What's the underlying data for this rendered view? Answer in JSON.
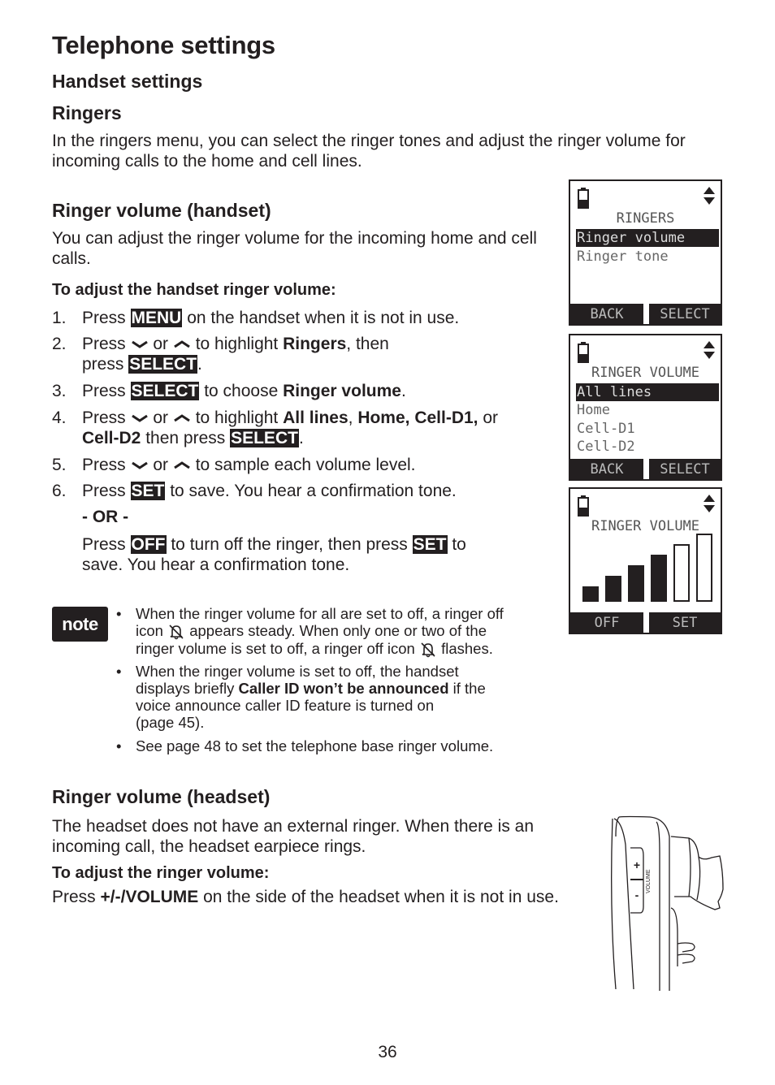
{
  "page": {
    "title": "Telephone settings",
    "section": "Handset settings",
    "subsection": "Ringers",
    "intro": "In the ringers menu, you can select the ringer tones and adjust the ringer volume for incoming calls to the home and cell lines.",
    "page_number": "36"
  },
  "handset": {
    "heading": "Ringer volume (handset)",
    "desc": "You can adjust the ringer volume for the incoming home and cell calls.",
    "procedure_title": "To adjust the handset ringer volume:",
    "steps": [
      {
        "num": "1.",
        "parts": [
          "Press ",
          "MENU",
          " on the handset when it is not in use."
        ]
      },
      {
        "num": "2.",
        "parts": [
          "Press ",
          " or ",
          " to highlight ",
          "Ringers",
          ", then",
          "press ",
          "SELECT",
          "."
        ]
      },
      {
        "num": "3.",
        "parts": [
          "Press ",
          "SELECT",
          " to choose ",
          "Ringer volume",
          "."
        ]
      },
      {
        "num": "4.",
        "parts": [
          "Press ",
          " or ",
          " to highlight ",
          "All lines",
          ", ",
          "Home, Cell-D1,",
          " or",
          "Cell-D2",
          " then press ",
          "SELECT",
          "."
        ]
      },
      {
        "num": "5.",
        "parts": [
          "Press ",
          " or ",
          " to sample each volume level."
        ]
      },
      {
        "num": "6.",
        "parts": [
          "Press ",
          "SET",
          " to save. You hear a confirmation tone."
        ]
      }
    ],
    "or_label": "- OR -",
    "alt": {
      "parts": [
        "Press ",
        "OFF",
        " to turn off the ringer, then press ",
        "SET",
        " to",
        "save. You hear a confirmation tone."
      ]
    }
  },
  "note": {
    "badge": "note",
    "bullets": [
      {
        "parts": [
          "When the ringer volume for all are set to off, a ringer off",
          "icon ",
          " appears steady. When only one or two of the",
          "ringer volume is set to off, a ringer off icon ",
          " flashes."
        ]
      },
      {
        "parts": [
          "When the ringer volume is set to off, the handset",
          "displays briefly ",
          "Caller ID won’t be announced",
          " if the",
          "voice announce caller ID feature is turned on",
          "(page 45)."
        ]
      },
      {
        "parts": [
          "See page 48 to set the telephone base ringer volume."
        ]
      }
    ],
    "bullet_char": "•"
  },
  "screens": [
    {
      "title": "RINGERS",
      "rows": [
        {
          "label": "Ringer volume",
          "selected": true
        },
        {
          "label": "Ringer tone",
          "selected": false
        }
      ],
      "softkeys": [
        "BACK",
        "SELECT"
      ]
    },
    {
      "title": "RINGER VOLUME",
      "rows": [
        {
          "label": "All lines",
          "selected": true
        },
        {
          "label": "Home",
          "selected": false
        },
        {
          "label": "Cell-D1",
          "selected": false
        },
        {
          "label": "Cell-D2",
          "selected": false
        }
      ],
      "softkeys": [
        "BACK",
        "SELECT"
      ]
    },
    {
      "title": "RINGER VOLUME",
      "volume_level": 4,
      "volume_max": 6,
      "softkeys": [
        "OFF",
        "SET"
      ]
    }
  ],
  "headset": {
    "heading": "Ringer volume (headset)",
    "desc": "The headset does not have an external ringer. When there is an incoming call, the headset earpiece rings.",
    "procedure_title": "To adjust the ringer volume:",
    "instruction": {
      "parts": [
        "Press ",
        "+/-/VOLUME",
        " on the side of the headset when it is not in use."
      ]
    },
    "illustration": {
      "plus": "+",
      "minus": "-",
      "label": "VOLUME"
    }
  },
  "icons": {
    "down": "chevron-down-icon",
    "up": "chevron-up-icon",
    "ringer_off": "ringer-off-icon",
    "battery": "battery-icon",
    "scroll": "scroll-arrows-icon"
  },
  "colors": {
    "ink": "#231f20",
    "lcd_text": "#666666",
    "paper": "#ffffff"
  }
}
